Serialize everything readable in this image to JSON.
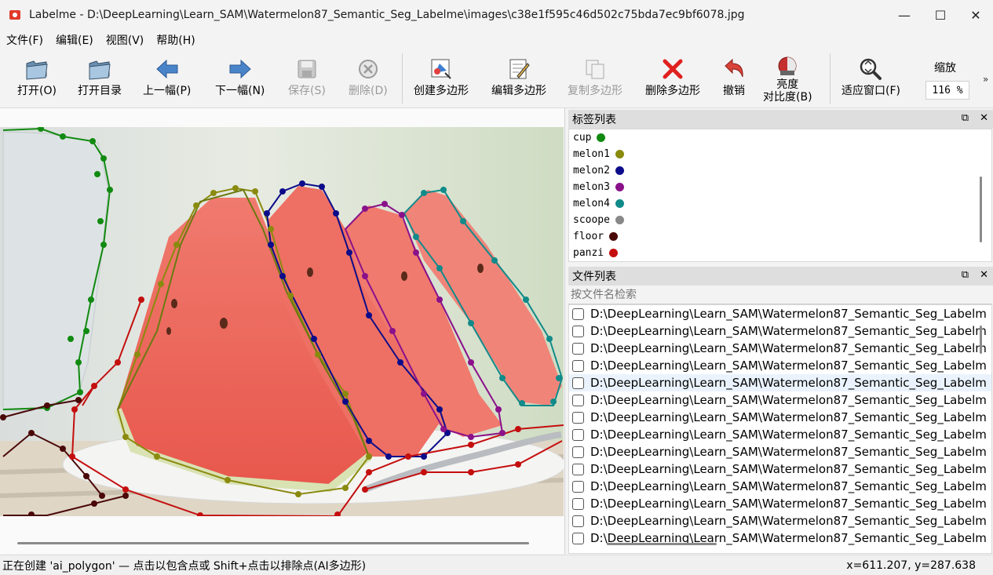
{
  "window": {
    "title": "Labelme - D:\\DeepLearning\\Learn_SAM\\Watermelon87_Semantic_Seg_Labelme\\images\\c38e1f595c46d502c75bda7ec9bf6078.jpg",
    "minimize": "—",
    "maximize": "☐",
    "close": "✕"
  },
  "menu": [
    "文件(F)",
    "编辑(E)",
    "视图(V)",
    "帮助(H)"
  ],
  "toolbar": {
    "open": "打开(O)",
    "open_dir": "打开目录",
    "prev": "上一幅(P)",
    "next": "下一幅(N)",
    "save": "保存(S)",
    "delete": "删除(D)",
    "create_polygon": "创建多边形",
    "edit_polygon": "编辑多边形",
    "copy_polygon": "复制多边形",
    "delete_polygon": "删除多边形",
    "undo": "撤销",
    "brightness_line1": "亮度",
    "brightness_line2": "对比度(B)",
    "fit_window": "适应窗口(F)",
    "zoom_label": "缩放",
    "zoom_value": "116 %",
    "more": "»"
  },
  "label_panel": {
    "title": "标签列表",
    "float": "⧉",
    "close": "✕",
    "labels": [
      {
        "name": "cup",
        "color": "#118a11"
      },
      {
        "name": "melon1",
        "color": "#8a8a0e"
      },
      {
        "name": "melon2",
        "color": "#0c0c8a"
      },
      {
        "name": "melon3",
        "color": "#8a118a"
      },
      {
        "name": "melon4",
        "color": "#118a8a"
      },
      {
        "name": "scoope",
        "color": "#888888"
      },
      {
        "name": "floor",
        "color": "#4a0808"
      },
      {
        "name": "panzi",
        "color": "#c40e0e"
      }
    ]
  },
  "file_panel": {
    "title": "文件列表",
    "float": "⧉",
    "close": "✕",
    "search_placeholder": "按文件名检索",
    "files": [
      "D:\\DeepLearning\\Learn_SAM\\Watermelon87_Semantic_Seg_Labelm",
      "D:\\DeepLearning\\Learn_SAM\\Watermelon87_Semantic_Seg_Labelm",
      "D:\\DeepLearning\\Learn_SAM\\Watermelon87_Semantic_Seg_Labelm",
      "D:\\DeepLearning\\Learn_SAM\\Watermelon87_Semantic_Seg_Labelm",
      "D:\\DeepLearning\\Learn_SAM\\Watermelon87_Semantic_Seg_Labelm",
      "D:\\DeepLearning\\Learn_SAM\\Watermelon87_Semantic_Seg_Labelm",
      "D:\\DeepLearning\\Learn_SAM\\Watermelon87_Semantic_Seg_Labelm",
      "D:\\DeepLearning\\Learn_SAM\\Watermelon87_Semantic_Seg_Labelm",
      "D:\\DeepLearning\\Learn_SAM\\Watermelon87_Semantic_Seg_Labelm",
      "D:\\DeepLearning\\Learn_SAM\\Watermelon87_Semantic_Seg_Labelm",
      "D:\\DeepLearning\\Learn_SAM\\Watermelon87_Semantic_Seg_Labelm",
      "D:\\DeepLearning\\Learn_SAM\\Watermelon87_Semantic_Seg_Labelm",
      "D:\\DeepLearning\\Learn_SAM\\Watermelon87_Semantic_Seg_Labelm",
      "D:\\DeepLearning\\Learn_SAM\\Watermelon87_Semantic_Seg_Labelm"
    ],
    "selected_index": 4
  },
  "status": {
    "message": "正在创建 'ai_polygon' — 点击以包含点或 Shift+点击以排除点(AI多边形)",
    "coords": "x=611.207, y=287.638"
  }
}
